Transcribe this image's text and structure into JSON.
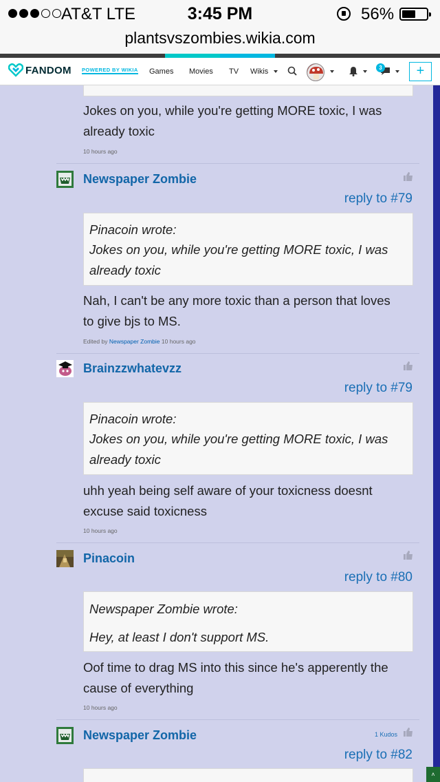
{
  "status_bar": {
    "carrier": "AT&T  LTE",
    "time": "3:45 PM",
    "battery": "56%",
    "battery_level": 0.56
  },
  "url": "plantsvszombies.wikia.com",
  "nav": {
    "logo": "FANDOM",
    "powered_by": "POWERED BY WIKIA",
    "links": [
      "Games",
      "Movies",
      "TV",
      "Wikis"
    ],
    "message_count": "3",
    "colors": {
      "strip": [
        "#3d3d3d",
        "#3d3d3d",
        "#3d3d3d",
        "#00c8c8",
        "#00b7e0",
        "#3d3d3d",
        "#3d3d3d",
        "#3d3d3d"
      ],
      "accent": "#00b7e0",
      "rail": "#23289a"
    }
  },
  "comments": [
    {
      "partial": true,
      "text": "Jokes on you, while you're getting MORE toxic, I was already toxic",
      "text_lines": [
        "Jokes on you, while you're getting MORE toxic, I was",
        "already toxic"
      ],
      "timestamp": "10 hours ago"
    },
    {
      "user": "Newspaper Zombie",
      "reply_to": "reply to #79",
      "quote_author": "Pinacoin wrote:",
      "quote_lines": [
        "Jokes on you, while you're getting MORE toxic, I was",
        "already toxic"
      ],
      "text_lines": [
        "Nah, I can't be any more toxic than a person that loves",
        "to give bjs to MS."
      ],
      "edited_by": "Edited by",
      "editor": "Newspaper Zombie",
      "timestamp": "10 hours ago"
    },
    {
      "user": "Brainzzwhatevzz",
      "reply_to": "reply to #79",
      "quote_author": "Pinacoin wrote:",
      "quote_lines": [
        "Jokes on you, while you're getting MORE toxic, I was",
        "already toxic"
      ],
      "text_lines": [
        "uhh yeah being self aware of your toxicness doesnt",
        "excuse said toxicness"
      ],
      "timestamp": "10 hours ago"
    },
    {
      "user": "Pinacoin",
      "reply_to": "reply to #80",
      "quote_author": "Newspaper Zombie wrote:",
      "quote_lines": [
        "Hey, at least I don't support MS."
      ],
      "text_lines": [
        "Oof time to drag MS into this since he's apperently the",
        "cause of everything"
      ],
      "timestamp": "10 hours ago"
    },
    {
      "user": "Newspaper Zombie",
      "reply_to": "reply to #82",
      "kudos": "1 Kudos"
    }
  ]
}
